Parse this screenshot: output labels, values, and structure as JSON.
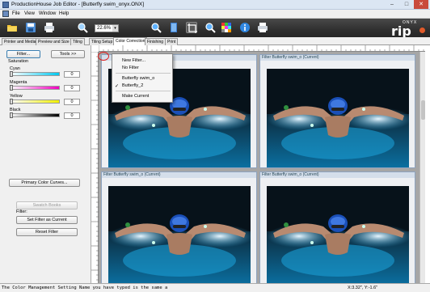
{
  "window": {
    "title": "ProductionHouse Job Editor - [Butterfly swim_onyx.ONX]",
    "minimize": "–",
    "maximize": "□",
    "close": "✕"
  },
  "menubar": {
    "items": [
      "File",
      "View",
      "Window",
      "Help"
    ]
  },
  "toolbar": {
    "zoom": "22.6%",
    "icons": [
      "open-folder-icon",
      "save-icon",
      "print-icon",
      "zoom-icon",
      "zoom-field",
      "search-icon",
      "book-icon",
      "crop-icon",
      "zoom-in-icon",
      "color-grid-icon",
      "info-icon",
      "printer-icon"
    ],
    "brand_top": "ONYX",
    "brand_main": "rip"
  },
  "tabs": [
    {
      "label": "Printer and Media",
      "active": false
    },
    {
      "label": "Preview and Size",
      "active": false
    },
    {
      "label": "Tiling",
      "active": false
    },
    {
      "label": "Tiling Setup",
      "active": false
    },
    {
      "label": "Color Correction",
      "active": true
    },
    {
      "label": "Finishing",
      "active": false
    },
    {
      "label": "Print",
      "active": false
    }
  ],
  "left_panel": {
    "filter_button": "Filter...",
    "tools_button": "Tools >>",
    "saturation_label": "Saturation",
    "channels": [
      {
        "name": "Cyan",
        "value": "0",
        "color": "#00c8f0"
      },
      {
        "name": "Magenta",
        "value": "0",
        "color": "#f000c0"
      },
      {
        "name": "Yellow",
        "value": "0",
        "color": "#f0f000"
      },
      {
        "name": "Black",
        "value": "0",
        "color": "#000000"
      }
    ],
    "primary_curves_button": "Primary Color Curves...",
    "swatch_books_button": "Swatch Books",
    "filter_label": "Filter:",
    "set_filter_button": "Set Filter as Current",
    "reset_filter_button": "Reset Filter"
  },
  "popup_menu": {
    "items": [
      {
        "label": "New Filter...",
        "checked": false
      },
      {
        "label": "No Filter",
        "checked": false
      },
      {
        "label": "Butterfly swim_o",
        "checked": false
      },
      {
        "label": "Butterfly_2",
        "checked": true
      },
      {
        "label": "Make Current",
        "checked": false
      }
    ],
    "check_mark": "✓"
  },
  "panes": [
    {
      "header": ""
    },
    {
      "header": "Filter Butterfly swim_o (Current)"
    },
    {
      "header": "Filter Butterfly swim_o (Current)"
    },
    {
      "header": "Filter Butterfly swim_o (Current)"
    }
  ],
  "statusbar": {
    "message": "The Color Management Setting Name you have typed is the same a",
    "coords": "X:3.32\", Y:-1.6\""
  }
}
